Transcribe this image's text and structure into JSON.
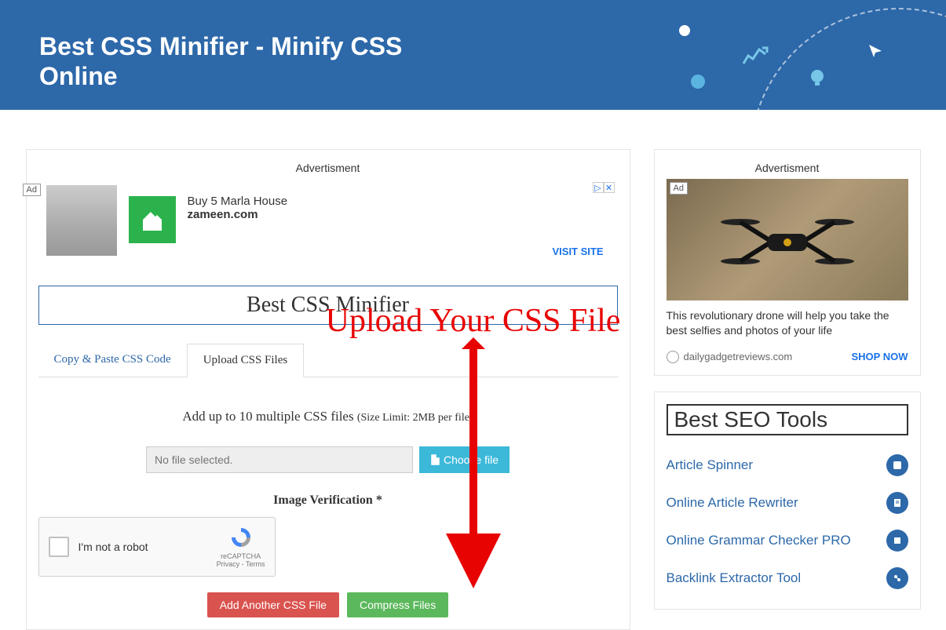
{
  "header": {
    "title": "Best CSS Minifier - Minify CSS Online"
  },
  "overlay": {
    "annotation": "Upload Your CSS File"
  },
  "main": {
    "advert_label": "Advertisment",
    "ad1": {
      "badge": "Ad",
      "headline": "Buy 5 Marla House",
      "domain": "zameen.com",
      "cta": "VISIT SITE"
    },
    "tool_heading": "Best CSS Minifier",
    "tabs": {
      "paste": "Copy & Paste CSS Code",
      "upload": "Upload CSS Files"
    },
    "upload": {
      "instruction_main": "Add up to 10 multiple CSS files ",
      "instruction_note": "(Size Limit: 2MB per file)",
      "file_placeholder": "No file selected.",
      "choose_btn": "Choose file",
      "verify_label": "Image Verification *"
    },
    "recaptcha": {
      "label": "I'm not a robot",
      "brand": "reCAPTCHA",
      "legal": "Privacy - Terms"
    },
    "actions": {
      "add_another": "Add Another CSS File",
      "compress": "Compress Files"
    }
  },
  "sidebar": {
    "advert_label": "Advertisment",
    "ad2": {
      "badge": "Ad",
      "text": "This revolutionary drone will help you take the best selfies and photos of your life",
      "source": "dailygadgetreviews.com",
      "cta": "SHOP NOW"
    },
    "seo": {
      "heading": "Best SEO Tools",
      "items": [
        "Article Spinner",
        "Online Article Rewriter",
        "Online Grammar Checker PRO",
        "Backlink Extractor Tool"
      ]
    }
  }
}
